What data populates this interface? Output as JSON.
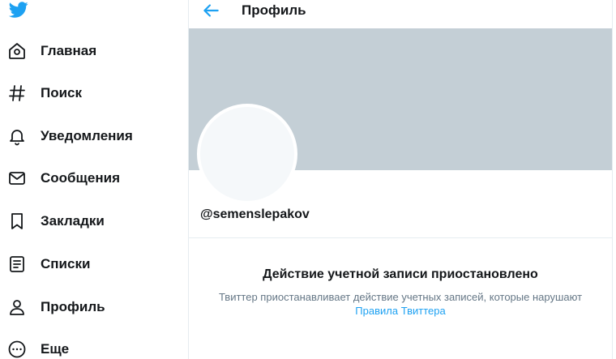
{
  "colors": {
    "accent": "#1da1f2",
    "banner": "#c4cfd6",
    "muted_text": "#657786",
    "border": "#e6ecf0"
  },
  "sidebar": {
    "logo_icon": "twitter-bird-icon",
    "items": [
      {
        "label": "Главная",
        "icon": "home-icon"
      },
      {
        "label": "Поиск",
        "icon": "hashtag-icon"
      },
      {
        "label": "Уведомления",
        "icon": "bell-icon"
      },
      {
        "label": "Сообщения",
        "icon": "envelope-icon"
      },
      {
        "label": "Закладки",
        "icon": "bookmark-icon"
      },
      {
        "label": "Списки",
        "icon": "list-icon"
      },
      {
        "label": "Профиль",
        "icon": "person-icon"
      },
      {
        "label": "Еще",
        "icon": "more-circle-icon"
      }
    ]
  },
  "header": {
    "back_icon": "arrow-left-icon",
    "title": "Профиль"
  },
  "profile": {
    "handle": "@semenslepakov"
  },
  "notice": {
    "title": "Действие учетной записи приостановлено",
    "description": "Твиттер приостанавливает действие учетных записей, которые нарушают",
    "link": "Правила Твиттера"
  }
}
